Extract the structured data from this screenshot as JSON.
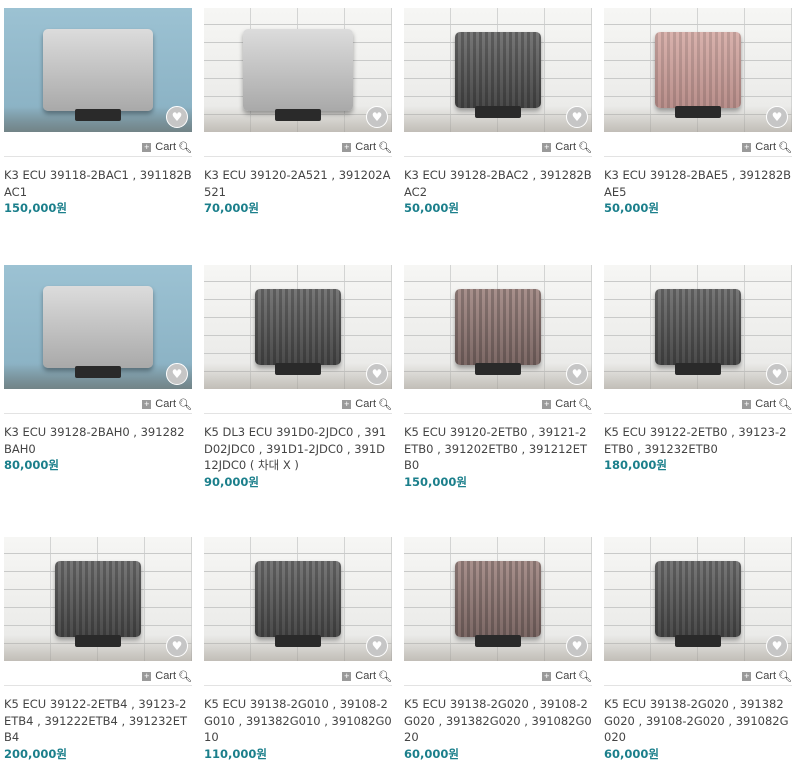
{
  "cart_label": "Cart",
  "products": [
    {
      "title": "K3 ECU 39118-2BAC1 , 391182BAC1",
      "price": "150,000원",
      "image": "ecu-silver-blue"
    },
    {
      "title": "K3 ECU 39120-2A521 , 391202A521",
      "price": "70,000원",
      "image": "ecu-silver-brick"
    },
    {
      "title": "K3 ECU 39128-2BAC2 , 391282BAC2",
      "price": "50,000원",
      "image": "ecu-dark-brick"
    },
    {
      "title": "K3 ECU 39128-2BAE5 , 391282BAE5",
      "price": "50,000원",
      "image": "ecu-pink-brick"
    },
    {
      "title": "K3 ECU 39128-2BAH0 , 391282BAH0",
      "price": "80,000원",
      "image": "ecu-silver-blue"
    },
    {
      "title": "K5 DL3 ECU 391D0-2JDC0 , 391D02JDC0 , 391D1-2JDC0 , 391D12JDC0 ( 차대 X )",
      "price": "90,000원",
      "image": "ecu-dark-brick"
    },
    {
      "title": "K5 ECU 39120-2ETB0 , 39121-2ETB0 , 391202ETB0 , 391212ETB0",
      "price": "150,000원",
      "image": "ecu-rose-brick"
    },
    {
      "title": "K5 ECU 39122-2ETB0 , 39123-2ETB0 , 391232ETB0",
      "price": "180,000원",
      "image": "ecu-dark-brick"
    },
    {
      "title": "K5 ECU 39122-2ETB4 , 39123-2ETB4 , 391222ETB4 , 391232ETB4",
      "price": "200,000원",
      "image": "ecu-dark-brick"
    },
    {
      "title": "K5 ECU 39138-2G010 , 39108-2G010 , 391382G010 , 391082G010",
      "price": "110,000원",
      "image": "ecu-dark-brick"
    },
    {
      "title": "K5 ECU 39138-2G020 , 39108-2G020 , 391382G020 , 391082G020",
      "price": "60,000원",
      "image": "ecu-rose-brick"
    },
    {
      "title": "K5 ECU 39138-2G020 , 391382G020 , 39108-2G020 , 391082G020",
      "price": "60,000원",
      "image": "ecu-dark-brick"
    }
  ]
}
